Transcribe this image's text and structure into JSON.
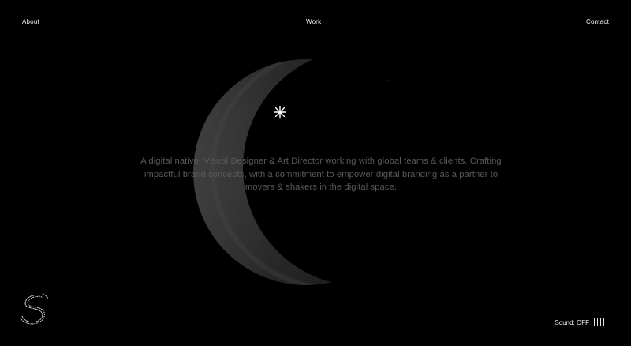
{
  "nav": {
    "about_label": "About",
    "work_label": "Work",
    "contact_label": "Contact"
  },
  "intro": {
    "lines": [
      "A digital native. Visual Designer & Art Director working with global teams & clients. Crafting",
      "impactful brand concepts, with a commitment to empower digital branding as a partner to",
      "movers & shakers in the digital space."
    ]
  },
  "sound": {
    "label": "Sound: OFF",
    "bars_count": 6
  },
  "icons": {
    "sparkle": "sparkle-icon",
    "logo": "circular-logo-icon",
    "moon": "crescent-moon"
  },
  "colors": {
    "background": "#000000",
    "nav_text": "#f2f2f2",
    "intro_text": "#5a5a5a"
  }
}
